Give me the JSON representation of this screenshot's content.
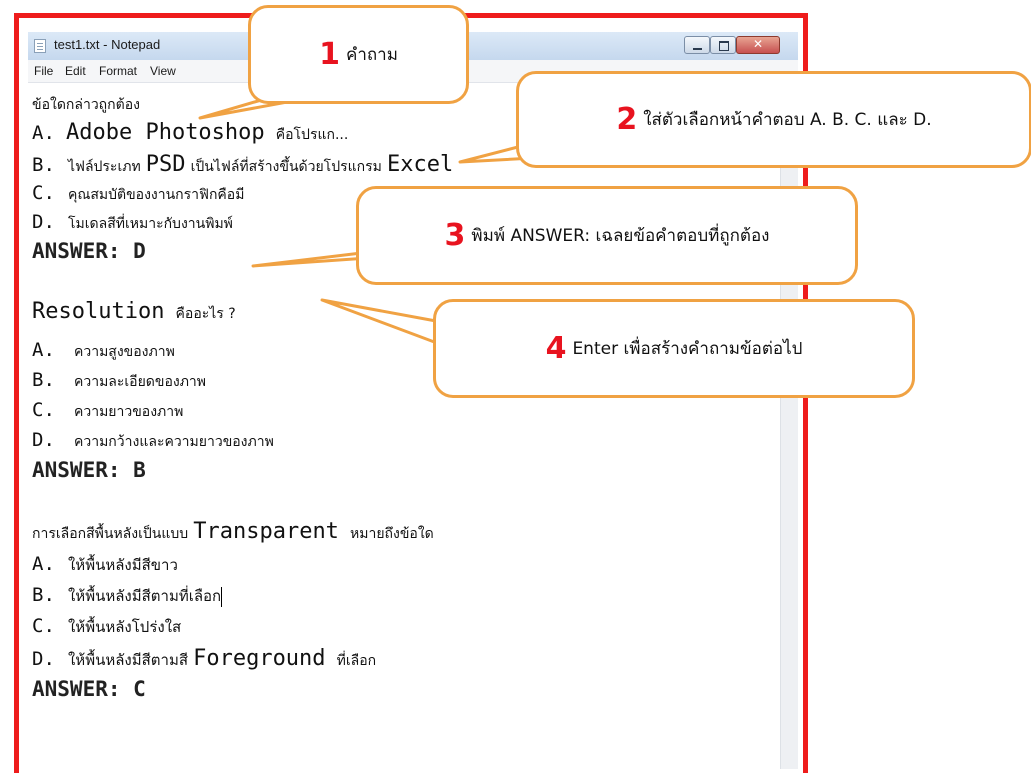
{
  "window": {
    "title": "test1.txt - Notepad",
    "menu": [
      "File",
      "Edit",
      "Format",
      "View"
    ]
  },
  "document": {
    "q1": {
      "question": "ข้อใดกล่าวถูกต้อง",
      "a": {
        "label": "A.",
        "en": "Adobe Photoshop",
        "th": "คือโปรแก..."
      },
      "b": {
        "label": "B.",
        "th1": "ไฟล์ประเภท",
        "en": "PSD",
        "th2": "เป็นไฟล์ที่สร้างขึ้นด้วยโปรแกรม",
        "en2": "Excel"
      },
      "c": {
        "label": "C.",
        "th": "คุณสมบัติของงานกราฟิกคือมี"
      },
      "d": {
        "label": "D.",
        "th": "โมเดลสีที่เหมาะกับงานพิมพ์"
      },
      "answer": "ANSWER: D"
    },
    "q2": {
      "en": "Resolution",
      "th": "คืออะไร ?",
      "a": {
        "label": "A.",
        "th": "ความสูงของภาพ"
      },
      "b": {
        "label": "B.",
        "th": "ความละเอียดของภาพ"
      },
      "c": {
        "label": "C.",
        "th": "ความยาวของภาพ"
      },
      "d": {
        "label": "D.",
        "th": "ความกว้างและความยาวของภาพ"
      },
      "answer": "ANSWER: B"
    },
    "q3": {
      "th1": "การเลือกสีพื้นหลังเป็นแบบ",
      "en": "Transparent",
      "th2": "หมายถึงข้อใด",
      "a": {
        "label": "A.",
        "th": "ให้พื้นหลังมีสีขาว"
      },
      "b": {
        "label": "B.",
        "th": "ให้พื้นหลังมีสีตามที่เลือก"
      },
      "c": {
        "label": "C.",
        "th": "ให้พื้นหลังโปร่งใส"
      },
      "d": {
        "label": "D.",
        "th1": "ให้พื้นหลังมีสีตามสี",
        "en": "Foreground",
        "th2": "ที่เลือก"
      },
      "answer": "ANSWER: C"
    }
  },
  "callouts": [
    {
      "number": "1",
      "text": "คำถาม"
    },
    {
      "number": "2",
      "text": "ใส่ตัวเลือกหน้าคำตอบ A. B. C. และ D."
    },
    {
      "number": "3",
      "text": "พิมพ์ ANSWER: เฉลยข้อคำตอบที่ถูกต้อง"
    },
    {
      "number": "4",
      "text": "Enter เพื่อสร้างคำถามข้อต่อไป"
    }
  ],
  "colors": {
    "frame": "#ee1c1c",
    "callout_border": "#f0a243",
    "callout_number": "#e8131f"
  }
}
